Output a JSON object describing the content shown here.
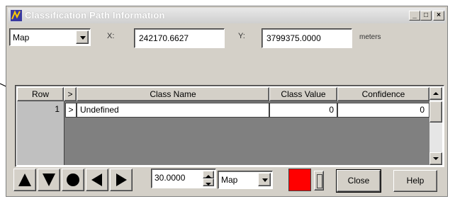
{
  "window": {
    "title": "Classification Path Information"
  },
  "controls_bar": {
    "source_select": "Map",
    "x_label": "X:",
    "x_value": "242170.6627",
    "y_label": "Y:",
    "y_value": "3799375.0000",
    "units": "meters"
  },
  "table": {
    "columns": [
      "Row",
      ">",
      "Class Name",
      "Class Value",
      "Confidence"
    ],
    "rows": [
      {
        "row": "1",
        "expand": ">",
        "class_name": "Undefined",
        "class_value": "0",
        "confidence": "0"
      }
    ]
  },
  "bottom": {
    "level_value": "30.0000",
    "view_select": "Map",
    "color": "#ff0000",
    "close_label": "Close",
    "help_label": "Help"
  },
  "colors": {
    "face": "#d4d0c8",
    "grid_bg": "#808080",
    "swatch": "#ff0000"
  }
}
